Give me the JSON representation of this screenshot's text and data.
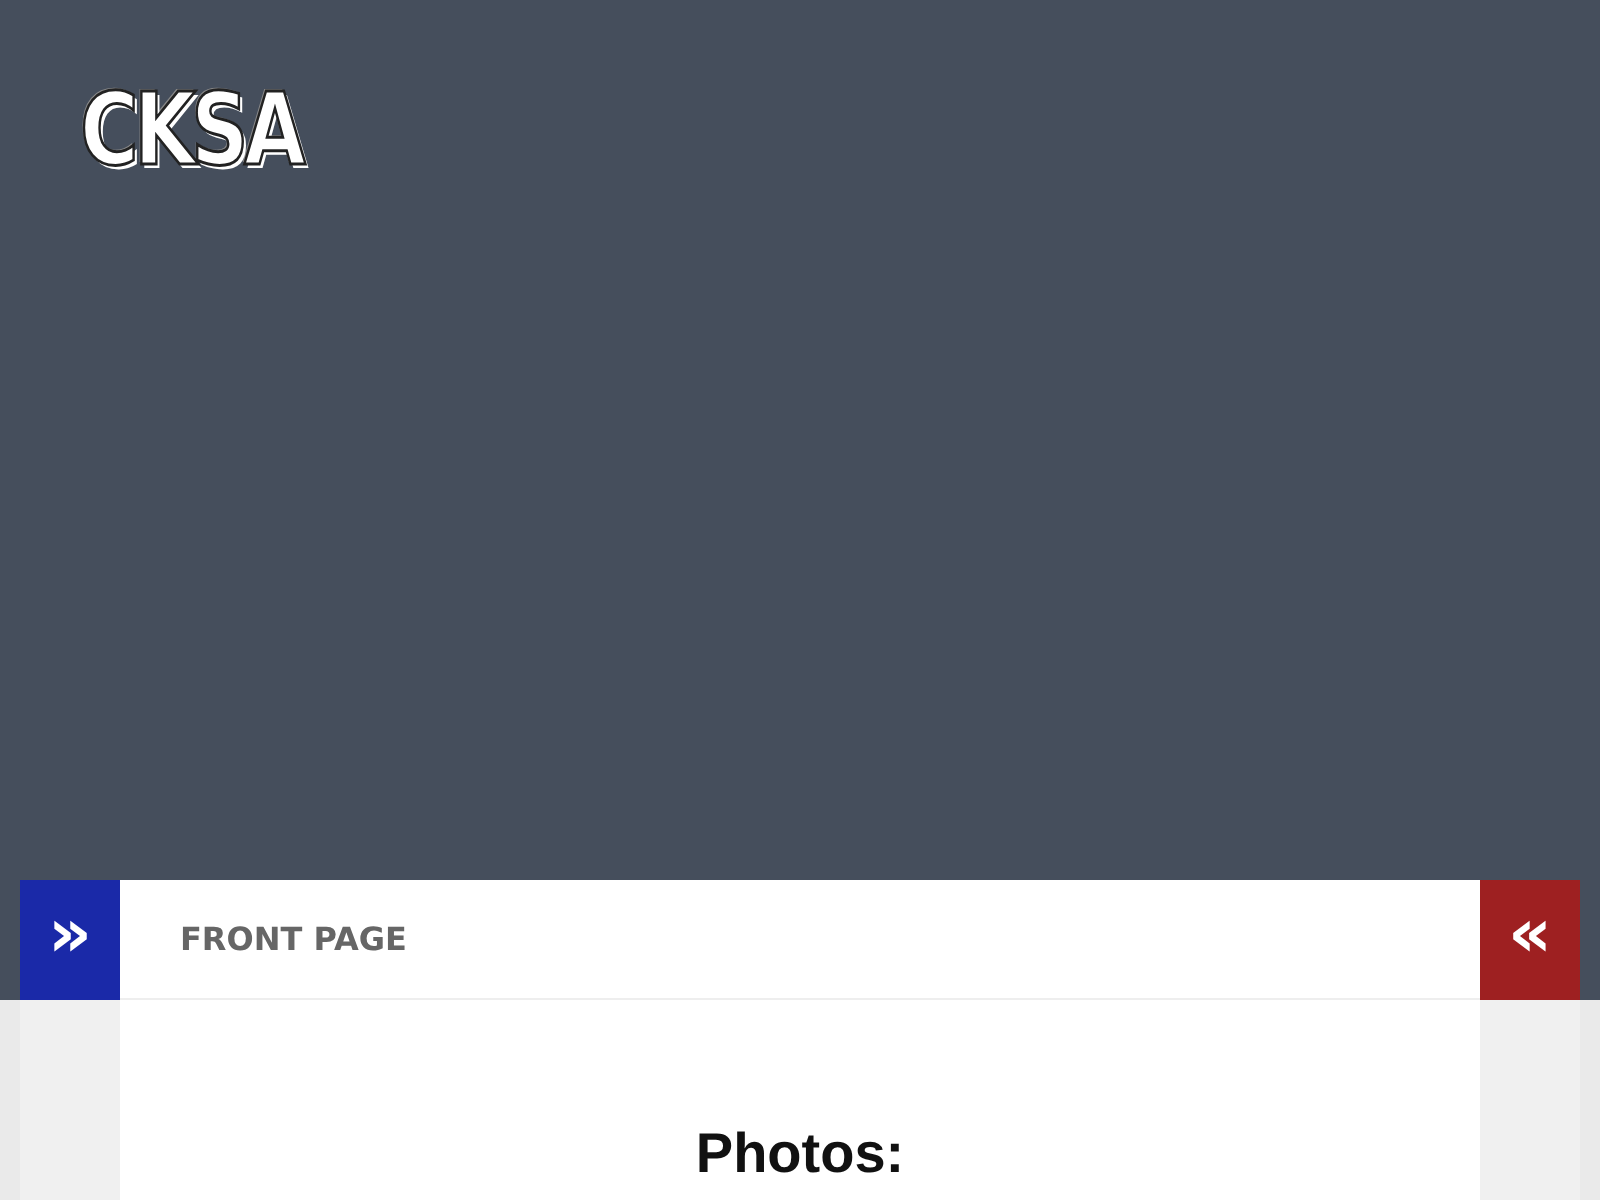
{
  "header": {
    "logo": "CKSA"
  },
  "nav_bar": {
    "left_toggle": "»",
    "label": "FRONT PAGE",
    "right_toggle": "«"
  },
  "content": {
    "heading": "Photos:"
  }
}
